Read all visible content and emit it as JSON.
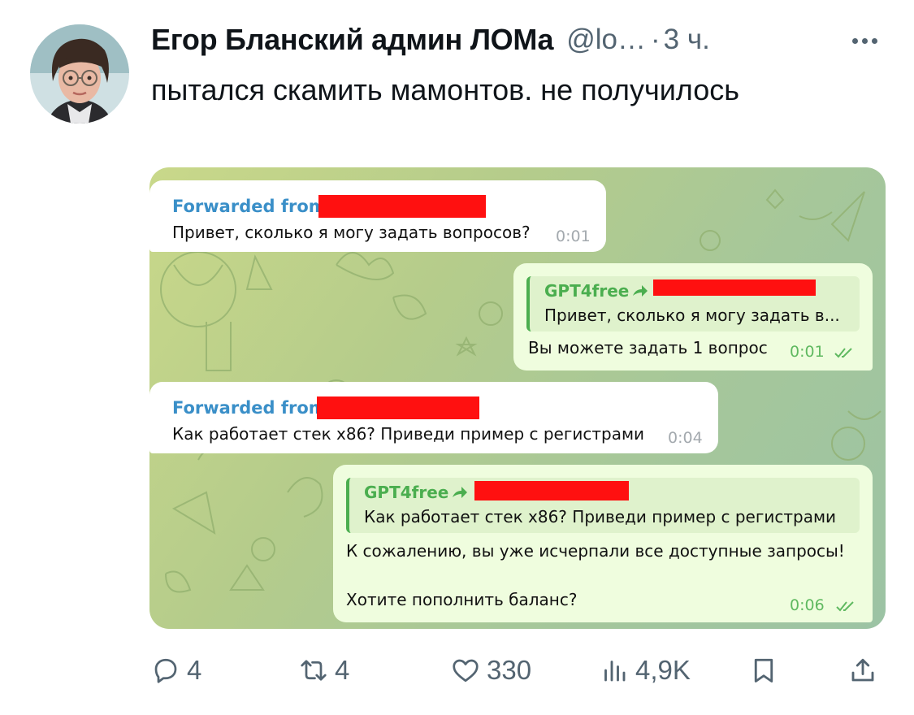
{
  "tweet": {
    "author_name": "Егор Бланский админ ЛОМа",
    "handle": "@lo…",
    "separator": "·",
    "time": "3 ч.",
    "text": "пытался скамить мамонтов. не получилось"
  },
  "chat": {
    "messages": [
      {
        "type": "incoming",
        "forwarded_label": "Forwarded from",
        "text": "Привет, сколько я могу задать вопросов?",
        "time": "0:01"
      },
      {
        "type": "outgoing",
        "reply_name": "GPT4free",
        "reply_text": "Привет, сколько я могу задать в...",
        "text": "Вы можете задать 1 вопрос",
        "time": "0:01"
      },
      {
        "type": "incoming",
        "forwarded_label": "Forwarded from",
        "text": "Как работает стек x86? Приведи пример с регистрами",
        "time": "0:04"
      },
      {
        "type": "outgoing",
        "reply_name": "GPT4free",
        "reply_text": "Как работает стек x86? Приведи пример с регистрами",
        "text_line1": "К сожалению, вы уже исчерпали все доступные запросы!",
        "text_line2": "Хотите пополнить баланс?",
        "time": "0:06"
      }
    ],
    "colors": {
      "incoming_bubble": "#ffffff",
      "outgoing_bubble": "#effdde",
      "forward_blue": "#3a8fc8",
      "reply_green": "#4bae4f",
      "redaction": "#ff1010"
    }
  },
  "actions": {
    "replies": "4",
    "retweets": "4",
    "likes": "330",
    "views": "4,9K"
  },
  "icons": [
    "more-icon",
    "reply-icon",
    "retweet-icon",
    "like-icon",
    "views-icon",
    "bookmark-icon",
    "share-icon",
    "forward-arrow-icon",
    "double-check-icon"
  ]
}
